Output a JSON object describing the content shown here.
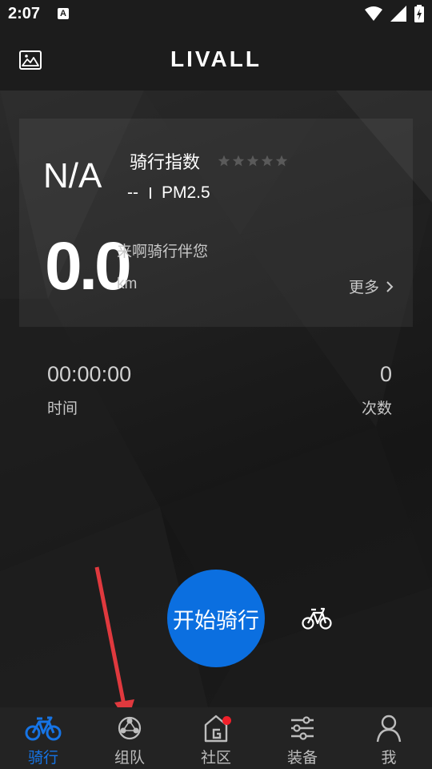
{
  "status_bar": {
    "time": "2:07",
    "notification_icon": "A"
  },
  "header": {
    "logo": "LIVALL"
  },
  "summary_card": {
    "index_value": "N/A",
    "ride_index_label": "骑行指数",
    "rating_stars": 0,
    "rating_max": 5,
    "pm_value": "--",
    "pm_label": "PM2.5",
    "distance_value": "0.0",
    "slogan": "来啊骑行伴您",
    "distance_unit": "km",
    "more_label": "更多"
  },
  "stats": {
    "time_value": "00:00:00",
    "time_label": "时间",
    "count_value": "0",
    "count_label": "次数"
  },
  "actions": {
    "start_label": "开始骑行",
    "bike_type_icon": "bicycle-icon"
  },
  "tabs": [
    {
      "label": "骑行",
      "icon": "bicycle-icon",
      "active": true
    },
    {
      "label": "组队",
      "icon": "team-icon",
      "active": false
    },
    {
      "label": "社区",
      "icon": "community-icon",
      "active": false,
      "badge": true
    },
    {
      "label": "装备",
      "icon": "equipment-icon",
      "active": false
    },
    {
      "label": "我",
      "icon": "profile-icon",
      "active": false
    }
  ],
  "colors": {
    "accent": "#0b6fe0",
    "active_tab": "#1674e5",
    "badge": "#f0202a",
    "annotation_arrow": "#e0393e"
  }
}
